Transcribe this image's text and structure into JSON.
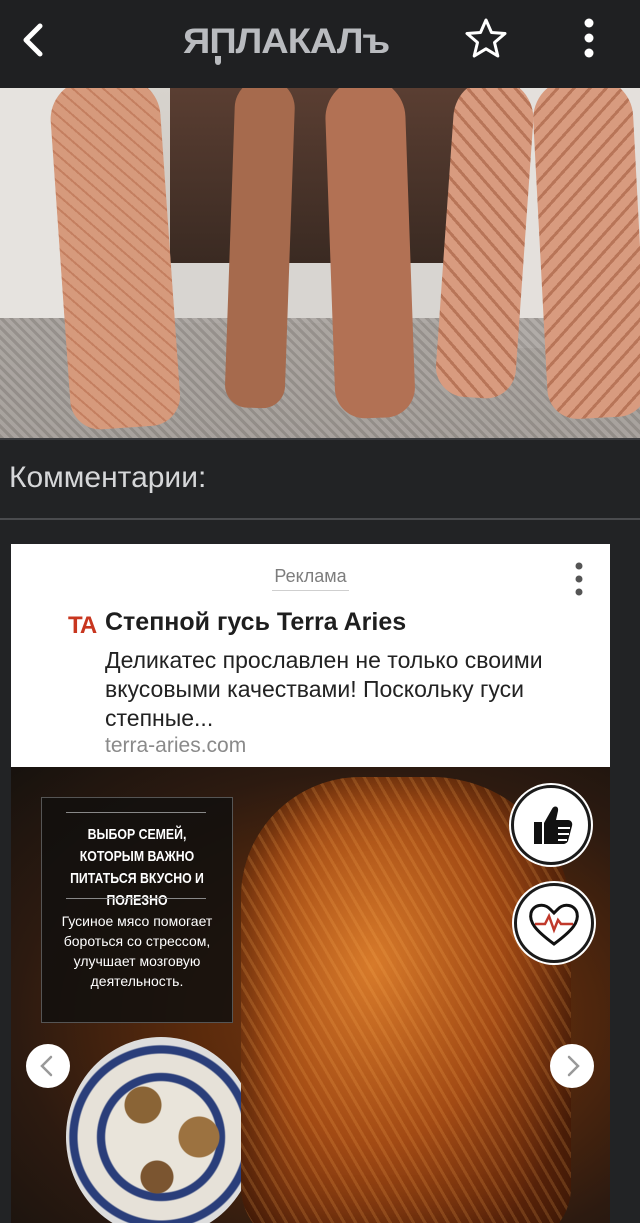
{
  "header": {
    "logo_text": "ЯПЛАКАЛъ",
    "icons": [
      "back-arrow-icon",
      "star-icon",
      "more-vertical-icon"
    ]
  },
  "comments": {
    "title": "Комментарии:"
  },
  "ad": {
    "label": "Реклама",
    "logo": "TA",
    "title": "Степной гусь Terra Aries",
    "description": "Деликатес прославлен не только своими вкусовыми качествами! Поскольку гуси степные...",
    "domain": "terra-aries.com",
    "image_headline": "ВЫБОР СЕМЕЙ, КОТОРЫМ ВАЖНО ПИТАТЬСЯ ВКУСНО И ПОЛЕЗНО",
    "image_body": "Гусиное мясо помогает бороться со стрессом, улучшает мозговую деятельность.",
    "badges": [
      "thumbs-up-icon",
      "heart-pulse-icon"
    ]
  },
  "colors": {
    "background": "#222325",
    "topbar": "#1f2022",
    "ad_background": "#ffffff",
    "ad_logo": "#c8361f"
  }
}
